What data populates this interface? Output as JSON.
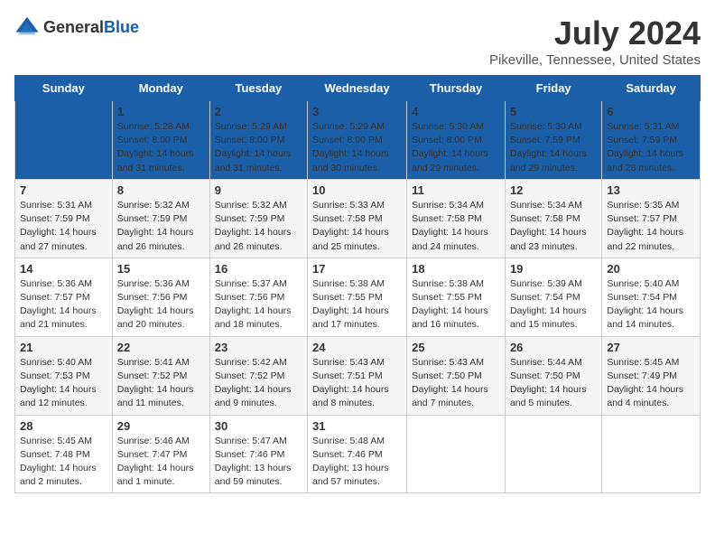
{
  "logo": {
    "general": "General",
    "blue": "Blue"
  },
  "title": "July 2024",
  "location": "Pikeville, Tennessee, United States",
  "weekdays": [
    "Sunday",
    "Monday",
    "Tuesday",
    "Wednesday",
    "Thursday",
    "Friday",
    "Saturday"
  ],
  "weeks": [
    [
      {
        "date": "",
        "info": ""
      },
      {
        "date": "1",
        "info": "Sunrise: 5:28 AM\nSunset: 8:00 PM\nDaylight: 14 hours\nand 31 minutes."
      },
      {
        "date": "2",
        "info": "Sunrise: 5:29 AM\nSunset: 8:00 PM\nDaylight: 14 hours\nand 31 minutes."
      },
      {
        "date": "3",
        "info": "Sunrise: 5:29 AM\nSunset: 8:00 PM\nDaylight: 14 hours\nand 30 minutes."
      },
      {
        "date": "4",
        "info": "Sunrise: 5:30 AM\nSunset: 8:00 PM\nDaylight: 14 hours\nand 29 minutes."
      },
      {
        "date": "5",
        "info": "Sunrise: 5:30 AM\nSunset: 7:59 PM\nDaylight: 14 hours\nand 29 minutes."
      },
      {
        "date": "6",
        "info": "Sunrise: 5:31 AM\nSunset: 7:59 PM\nDaylight: 14 hours\nand 28 minutes."
      }
    ],
    [
      {
        "date": "7",
        "info": "Sunrise: 5:31 AM\nSunset: 7:59 PM\nDaylight: 14 hours\nand 27 minutes."
      },
      {
        "date": "8",
        "info": "Sunrise: 5:32 AM\nSunset: 7:59 PM\nDaylight: 14 hours\nand 26 minutes."
      },
      {
        "date": "9",
        "info": "Sunrise: 5:32 AM\nSunset: 7:59 PM\nDaylight: 14 hours\nand 26 minutes."
      },
      {
        "date": "10",
        "info": "Sunrise: 5:33 AM\nSunset: 7:58 PM\nDaylight: 14 hours\nand 25 minutes."
      },
      {
        "date": "11",
        "info": "Sunrise: 5:34 AM\nSunset: 7:58 PM\nDaylight: 14 hours\nand 24 minutes."
      },
      {
        "date": "12",
        "info": "Sunrise: 5:34 AM\nSunset: 7:58 PM\nDaylight: 14 hours\nand 23 minutes."
      },
      {
        "date": "13",
        "info": "Sunrise: 5:35 AM\nSunset: 7:57 PM\nDaylight: 14 hours\nand 22 minutes."
      }
    ],
    [
      {
        "date": "14",
        "info": "Sunrise: 5:36 AM\nSunset: 7:57 PM\nDaylight: 14 hours\nand 21 minutes."
      },
      {
        "date": "15",
        "info": "Sunrise: 5:36 AM\nSunset: 7:56 PM\nDaylight: 14 hours\nand 20 minutes."
      },
      {
        "date": "16",
        "info": "Sunrise: 5:37 AM\nSunset: 7:56 PM\nDaylight: 14 hours\nand 18 minutes."
      },
      {
        "date": "17",
        "info": "Sunrise: 5:38 AM\nSunset: 7:55 PM\nDaylight: 14 hours\nand 17 minutes."
      },
      {
        "date": "18",
        "info": "Sunrise: 5:38 AM\nSunset: 7:55 PM\nDaylight: 14 hours\nand 16 minutes."
      },
      {
        "date": "19",
        "info": "Sunrise: 5:39 AM\nSunset: 7:54 PM\nDaylight: 14 hours\nand 15 minutes."
      },
      {
        "date": "20",
        "info": "Sunrise: 5:40 AM\nSunset: 7:54 PM\nDaylight: 14 hours\nand 14 minutes."
      }
    ],
    [
      {
        "date": "21",
        "info": "Sunrise: 5:40 AM\nSunset: 7:53 PM\nDaylight: 14 hours\nand 12 minutes."
      },
      {
        "date": "22",
        "info": "Sunrise: 5:41 AM\nSunset: 7:52 PM\nDaylight: 14 hours\nand 11 minutes."
      },
      {
        "date": "23",
        "info": "Sunrise: 5:42 AM\nSunset: 7:52 PM\nDaylight: 14 hours\nand 9 minutes."
      },
      {
        "date": "24",
        "info": "Sunrise: 5:43 AM\nSunset: 7:51 PM\nDaylight: 14 hours\nand 8 minutes."
      },
      {
        "date": "25",
        "info": "Sunrise: 5:43 AM\nSunset: 7:50 PM\nDaylight: 14 hours\nand 7 minutes."
      },
      {
        "date": "26",
        "info": "Sunrise: 5:44 AM\nSunset: 7:50 PM\nDaylight: 14 hours\nand 5 minutes."
      },
      {
        "date": "27",
        "info": "Sunrise: 5:45 AM\nSunset: 7:49 PM\nDaylight: 14 hours\nand 4 minutes."
      }
    ],
    [
      {
        "date": "28",
        "info": "Sunrise: 5:45 AM\nSunset: 7:48 PM\nDaylight: 14 hours\nand 2 minutes."
      },
      {
        "date": "29",
        "info": "Sunrise: 5:46 AM\nSunset: 7:47 PM\nDaylight: 14 hours\nand 1 minute."
      },
      {
        "date": "30",
        "info": "Sunrise: 5:47 AM\nSunset: 7:46 PM\nDaylight: 13 hours\nand 59 minutes."
      },
      {
        "date": "31",
        "info": "Sunrise: 5:48 AM\nSunset: 7:46 PM\nDaylight: 13 hours\nand 57 minutes."
      },
      {
        "date": "",
        "info": ""
      },
      {
        "date": "",
        "info": ""
      },
      {
        "date": "",
        "info": ""
      }
    ]
  ]
}
